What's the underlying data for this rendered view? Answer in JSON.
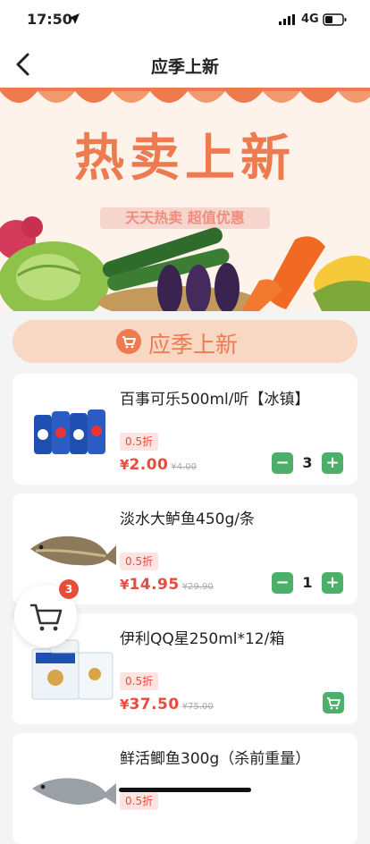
{
  "status_bar": {
    "time": "17:50",
    "network": "4G"
  },
  "nav": {
    "title": "应季上新"
  },
  "banner": {
    "title": "热卖上新",
    "subtitle": "天天热卖 超值优惠"
  },
  "section": {
    "title": "应季上新"
  },
  "products": [
    {
      "name": "百事可乐500ml/听【冰镇】",
      "discount": "0.5折",
      "currency": "¥",
      "price": "2.00",
      "original_price": "¥4.00",
      "quantity": "3"
    },
    {
      "name": "淡水大鲈鱼450g/条",
      "discount": "0.5折",
      "currency": "¥",
      "price": "14.95",
      "original_price": "¥29.90",
      "quantity": "1"
    },
    {
      "name": "伊利QQ星250ml*12/箱",
      "discount": "0.5折",
      "currency": "¥",
      "price": "37.50",
      "original_price": "¥75.00"
    },
    {
      "name": "鲜活鲫鱼300g（杀前重量）",
      "discount": "0.5折"
    }
  ],
  "cart": {
    "badge_count": "3"
  },
  "colors": {
    "accent": "#ee7a4f",
    "price_red": "#e94b3c",
    "button_green": "#4caf6a",
    "section_bg": "#f8d7c3"
  },
  "icons": [
    "location-arrow-icon",
    "signal-icon",
    "battery-icon",
    "back-icon",
    "cart-icon",
    "minus-icon",
    "plus-icon"
  ]
}
